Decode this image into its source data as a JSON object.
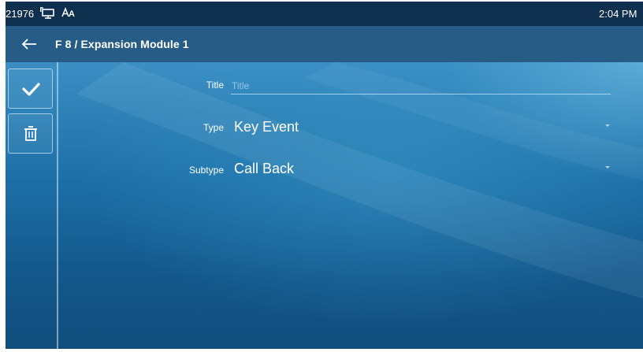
{
  "status_bar": {
    "account_id": "21976",
    "time": "2:04 PM",
    "icons": [
      "network-icon",
      "input-method-icon"
    ],
    "input_method_label": "A"
  },
  "header": {
    "back_icon": "arrow-left-icon",
    "title": "F 8 / Expansion Module 1"
  },
  "toolbar": {
    "save_icon": "checkmark-icon",
    "delete_icon": "trash-icon"
  },
  "form": {
    "title": {
      "label": "Title",
      "value": "",
      "placeholder": "Title"
    },
    "type": {
      "label": "Type",
      "value": "Key Event"
    },
    "subtype": {
      "label": "Subtype",
      "value": "Call Back"
    }
  },
  "colors": {
    "status_bar": "#0e2f4e",
    "title_bar": "#275c86",
    "content_base": "#1d70a8",
    "text": "#ffffff"
  }
}
